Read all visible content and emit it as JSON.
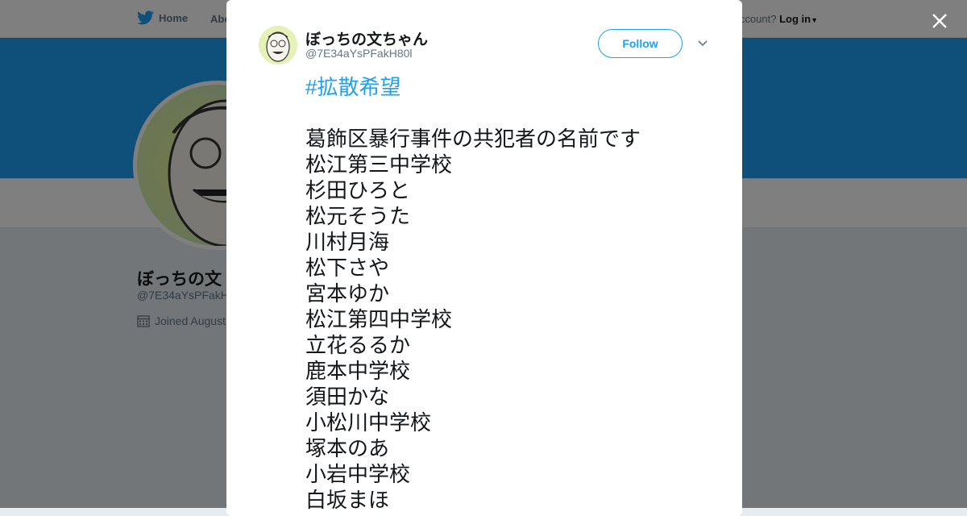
{
  "topbar": {
    "home_label": "Home",
    "about_label": "Abo",
    "account_prefix": "ccount?",
    "login_label": "Log in"
  },
  "profile": {
    "name": "ぼっちの文",
    "handle": "@7E34aYsPFakH",
    "joined": "Joined August"
  },
  "tweet": {
    "author_name": "ぼっちの文ちゃん",
    "author_handle": "@7E34aYsPFakH80l",
    "follow_label": "Follow",
    "hashtag": "#拡散希望",
    "lines": [
      "葛飾区暴行事件の共犯者の名前です",
      "松江第三中学校",
      "杉田ひろと",
      "松元そうた",
      "川村月海",
      "松下さや",
      "宮本ゆか",
      "松江第四中学校",
      "立花るるか",
      "鹿本中学校",
      "須田かな",
      "小松川中学校",
      "塚本のあ",
      "小岩中学校",
      "白坂まほ"
    ]
  },
  "colors": {
    "brand": "#1da1f2",
    "text": "#14171a",
    "muted": "#657786"
  }
}
